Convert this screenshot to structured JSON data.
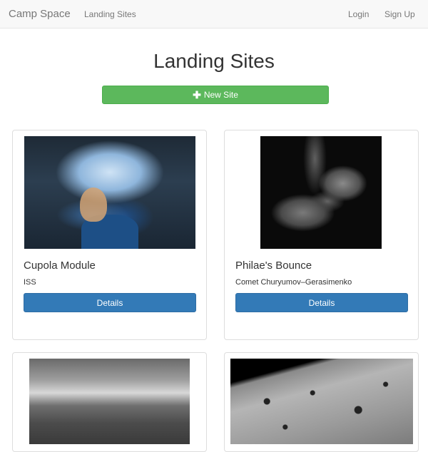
{
  "navbar": {
    "brand": "Camp Space",
    "links": {
      "landing": "Landing Sites",
      "login": "Login",
      "signup": "Sign Up"
    }
  },
  "header": {
    "title": "Landing Sites",
    "new_site_label": "New Site",
    "new_site_icon": "plus-icon"
  },
  "sites": [
    {
      "title": "Cupola Module",
      "location": "ISS",
      "button": "Details"
    },
    {
      "title": "Philae's Bounce",
      "location": "Comet Churyumov–Gerasimenko",
      "button": "Details"
    }
  ],
  "colors": {
    "navbar_bg": "#f8f8f8",
    "success": "#5cb85c",
    "primary": "#337ab7"
  }
}
